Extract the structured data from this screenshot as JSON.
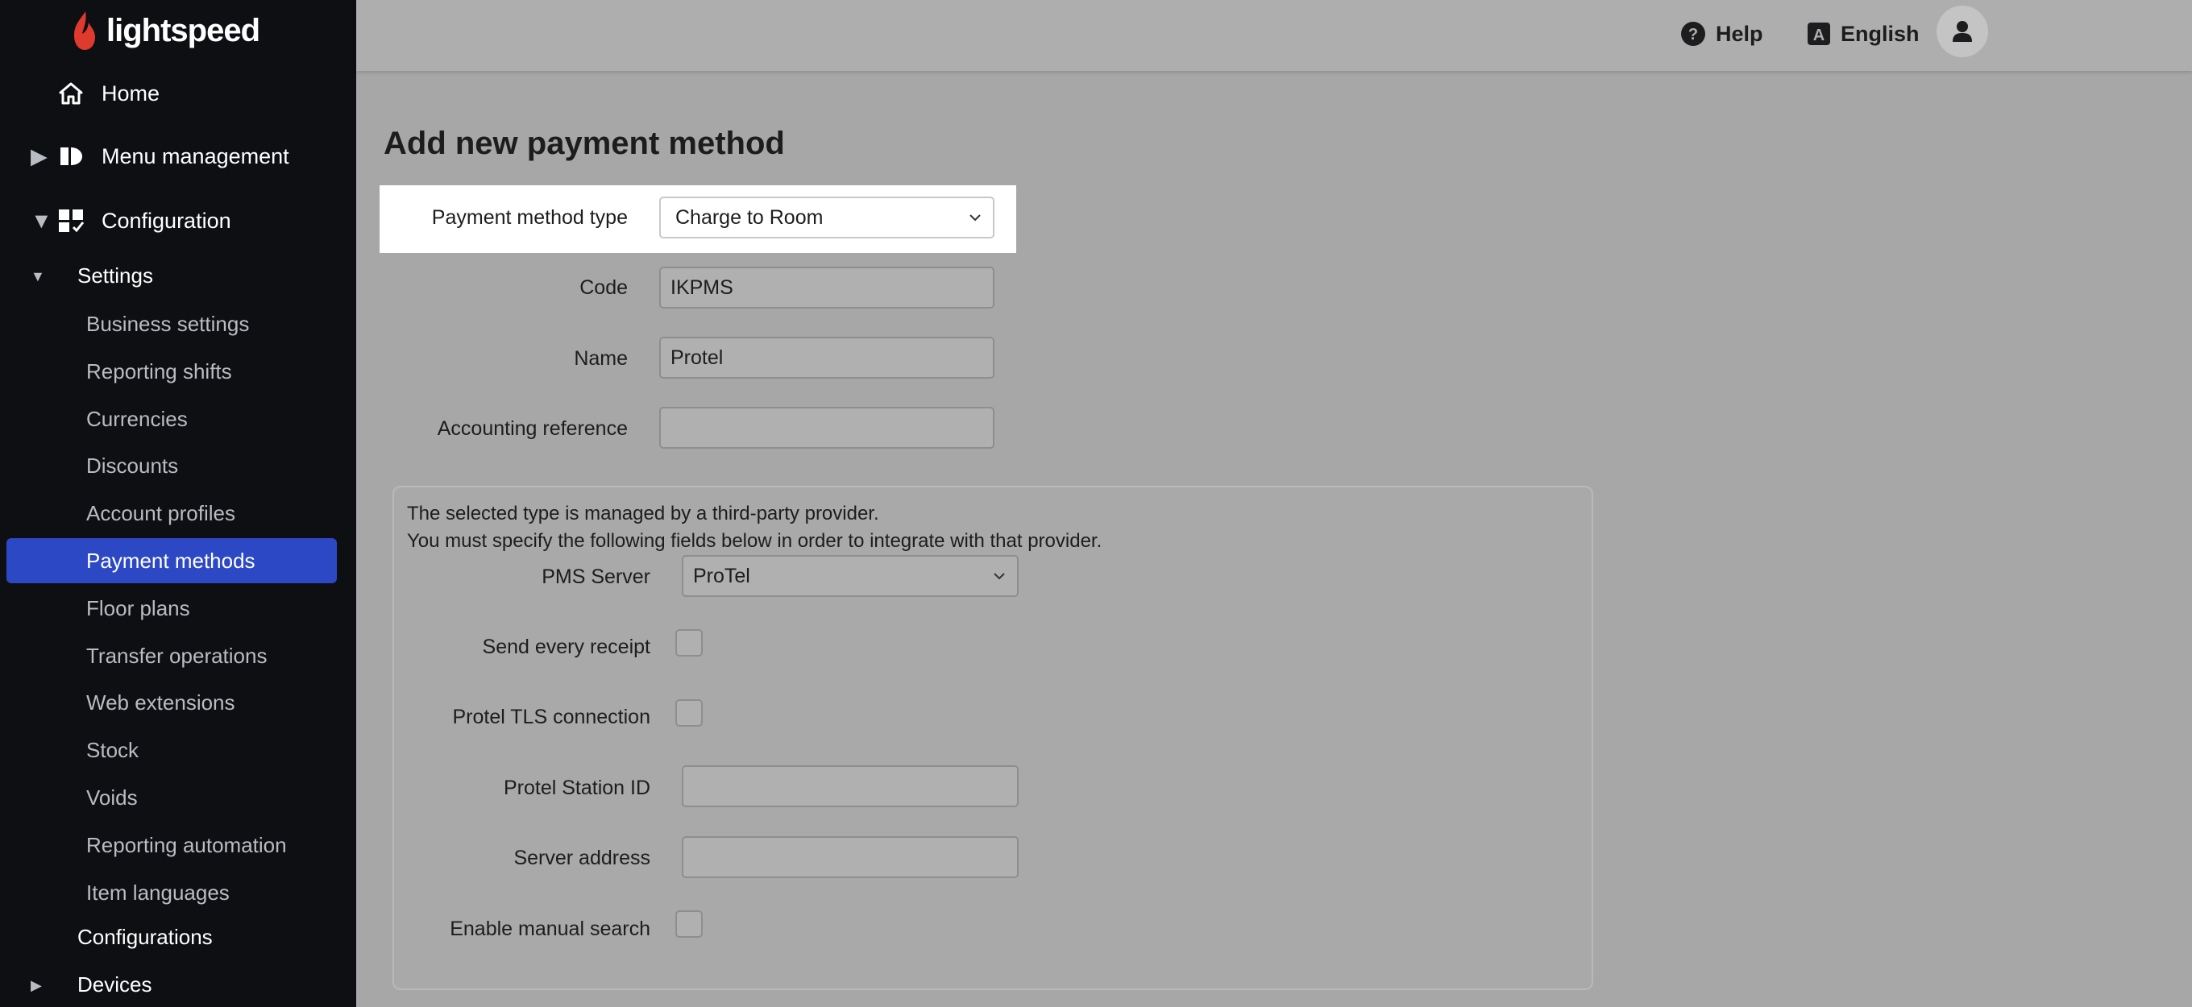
{
  "brand": {
    "name": "lightspeed"
  },
  "sidebar": {
    "top_items": [
      {
        "label": "Home",
        "icon": "home-icon"
      },
      {
        "label": "Menu management",
        "icon": "menu-management-icon"
      },
      {
        "label": "Configuration",
        "icon": "configuration-icon"
      }
    ],
    "settings": {
      "label": "Settings",
      "items": [
        "Business settings",
        "Reporting shifts",
        "Currencies",
        "Discounts",
        "Account profiles",
        "Payment methods",
        "Floor plans",
        "Transfer operations",
        "Web extensions",
        "Stock",
        "Voids",
        "Reporting automation",
        "Item languages"
      ],
      "active_item": "Payment methods"
    },
    "configurations_label": "Configurations",
    "devices_label": "Devices"
  },
  "topbar": {
    "help_label": "Help",
    "language_label": "English"
  },
  "form": {
    "title": "Add new payment method",
    "payment_method_type": {
      "label": "Payment method type",
      "value": "Charge to Room"
    },
    "code": {
      "label": "Code",
      "value": "IKPMS"
    },
    "name": {
      "label": "Name",
      "value": "Protel"
    },
    "accounting_reference": {
      "label": "Accounting reference",
      "value": ""
    }
  },
  "provider": {
    "line1": "The selected type is managed by a third-party provider.",
    "line2": "You must specify the following fields below in order to integrate with that provider.",
    "pms_server": {
      "label": "PMS Server",
      "value": "ProTel"
    },
    "send_every_receipt": {
      "label": "Send every receipt",
      "checked": false
    },
    "protel_tls": {
      "label": "Protel TLS connection",
      "checked": false
    },
    "station_id": {
      "label": "Protel Station ID",
      "value": ""
    },
    "server_address": {
      "label": "Server address",
      "value": ""
    },
    "manual_search": {
      "label": "Enable manual search",
      "checked": false
    }
  },
  "colors": {
    "sidebar_bg": "#0e0f12",
    "active_item_bg": "#2d48c5",
    "brand_red": "#e03a2f",
    "overlay_gray": "#a7a7a7"
  }
}
